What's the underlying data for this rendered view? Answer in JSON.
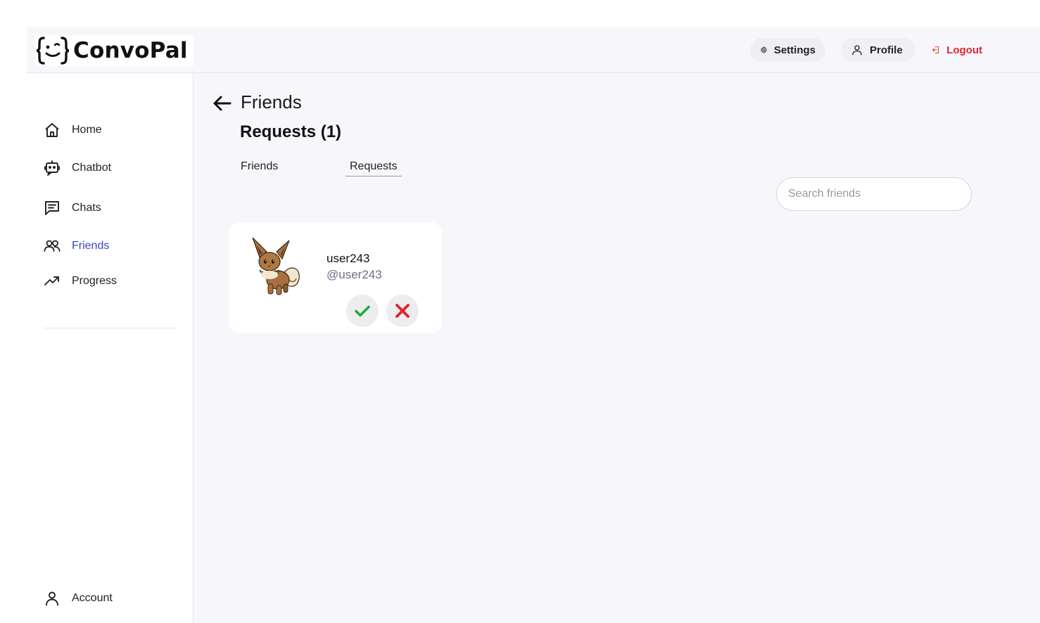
{
  "app": {
    "name": "ConvoPal"
  },
  "header": {
    "settings_label": "Settings",
    "profile_label": "Profile",
    "logout_label": "Logout"
  },
  "sidebar": {
    "items": [
      {
        "label": "Home",
        "icon": "home-icon"
      },
      {
        "label": "Chatbot",
        "icon": "robot-icon"
      },
      {
        "label": "Chats",
        "icon": "chat-icon"
      },
      {
        "label": "Friends",
        "icon": "friends-icon",
        "active": true
      },
      {
        "label": "Progress",
        "icon": "trending-up-icon"
      }
    ],
    "account_label": "Account"
  },
  "main": {
    "title": "Friends",
    "section_title": "Requests (1)",
    "tabs": [
      {
        "label": "Friends"
      },
      {
        "label": "Requests",
        "selected": true
      }
    ],
    "search": {
      "placeholder": "Search friends",
      "value": ""
    },
    "requests": [
      {
        "username": "user243",
        "handle": "@user243",
        "avatar": "eevee-avatar"
      }
    ]
  },
  "colors": {
    "accent": "#3b46c4",
    "logout": "#e0252b",
    "accept": "#1fae3c",
    "decline": "#e0252b",
    "background": "#f7f7fb"
  }
}
